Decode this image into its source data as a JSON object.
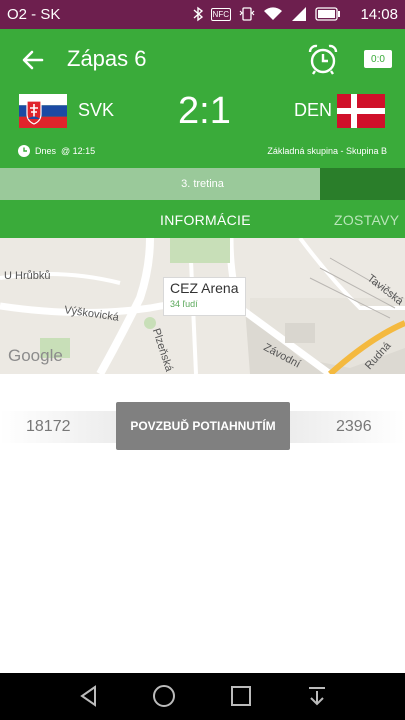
{
  "status_bar": {
    "carrier": "O2 - SK",
    "time": "14:08",
    "nfc_label": "NFC"
  },
  "app_bar": {
    "title": "Zápas 6",
    "score_icon_text": "0:0"
  },
  "match": {
    "home": {
      "code": "SVK",
      "flag": "slovakia"
    },
    "away": {
      "code": "DEN",
      "flag": "denmark"
    },
    "score": "2:1",
    "date_time": "Dnes  @ 12:15",
    "group": "Základná skupina - Skupina B",
    "period": "3. tretina",
    "progress": 0.79
  },
  "tabs": [
    {
      "label": "INFORMÁCIE",
      "active": true
    },
    {
      "label": "ZOSTAVY",
      "active": false
    }
  ],
  "map": {
    "venue": "CEZ Arena",
    "attendance": "34 ľudí",
    "logo": "Google",
    "streets": [
      "U Hrůbků",
      "Výškovická",
      "Plzeňská",
      "Závodní",
      "Rudná",
      "Tavičská"
    ]
  },
  "cheer": {
    "home_count": "18172",
    "away_count": "2396",
    "button_label": "POVZBUĎ POTIAHNUTÍM"
  },
  "colors": {
    "status_bar": "#6d1f4e",
    "primary_green": "#3aab3a",
    "progress_track": "#2a7e2a",
    "progress_fill": "#9ac99a"
  }
}
